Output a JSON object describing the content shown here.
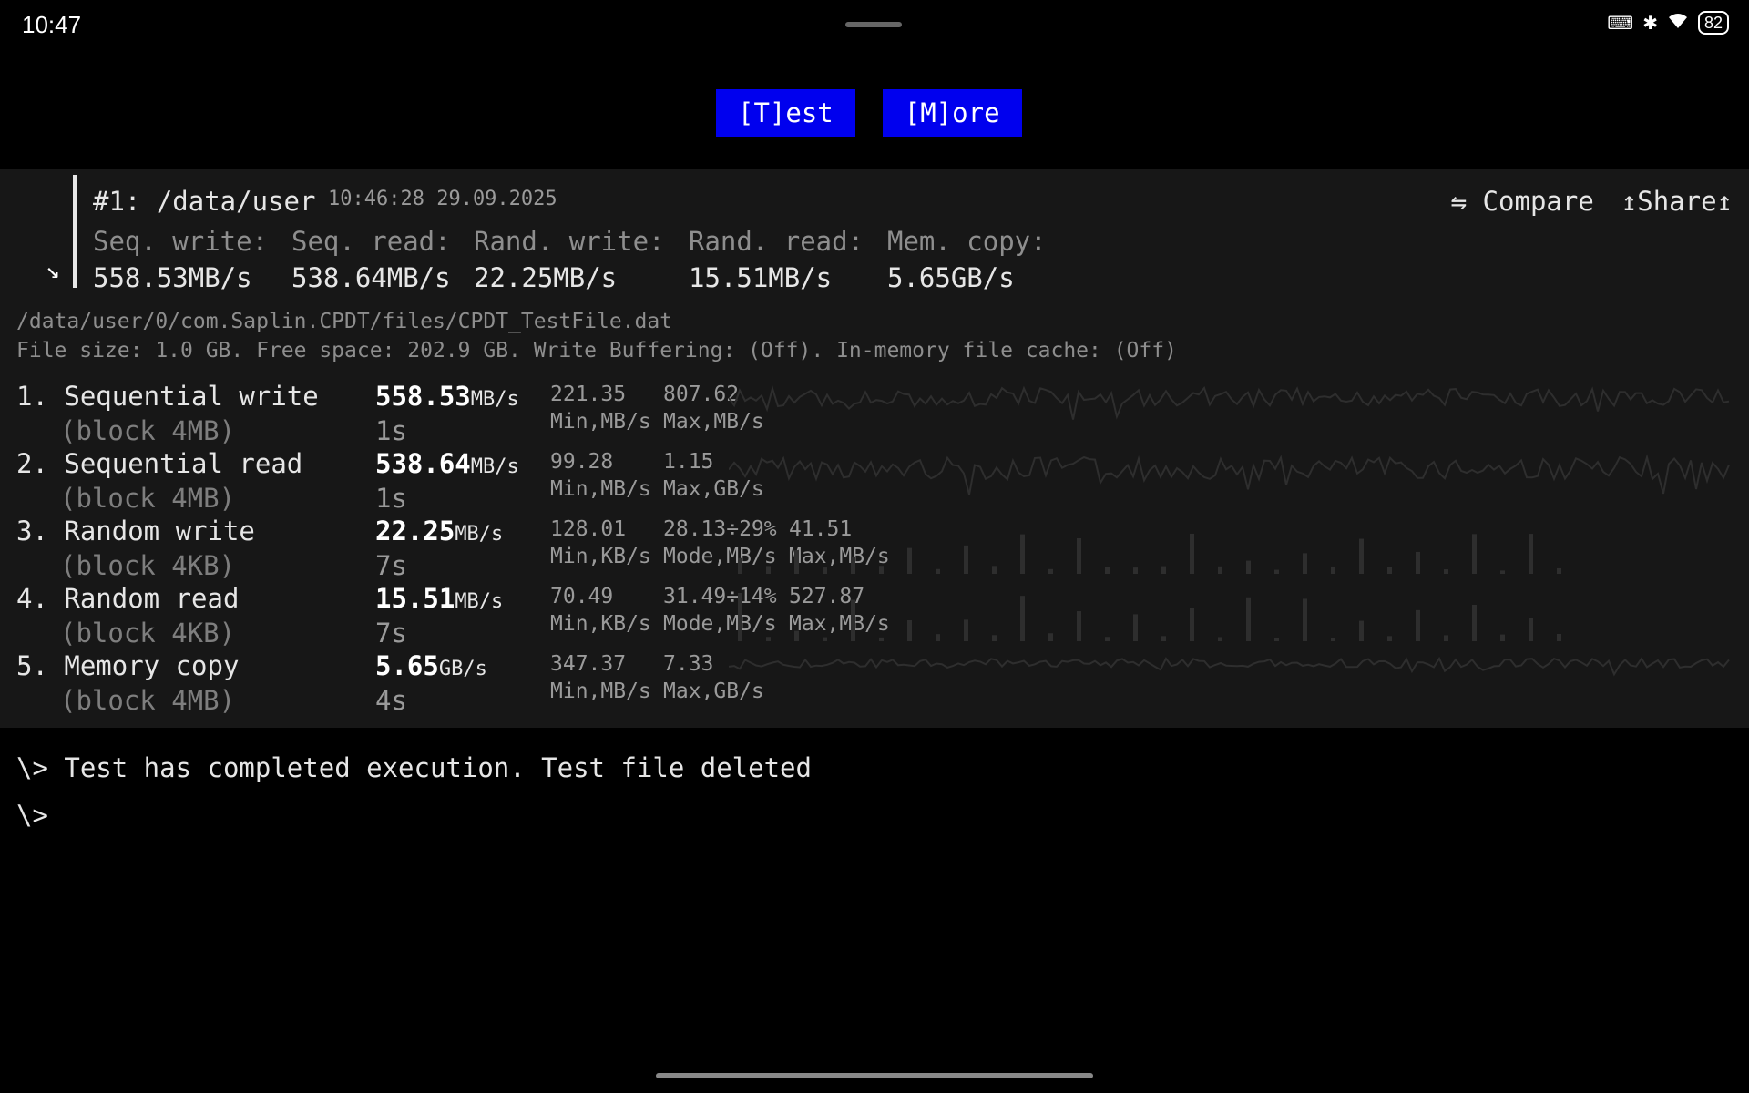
{
  "status_bar": {
    "time": "10:47",
    "battery": "82"
  },
  "toolbar": {
    "test_label": "[T]est",
    "more_label": "[M]ore"
  },
  "result_card": {
    "title": "#1: /data/user",
    "timestamp": "10:46:28 29.09.2025",
    "compare_label": "⇋ Compare",
    "share_label": "↥Share↥",
    "summary": [
      {
        "label": "Seq. write:",
        "value": "558.53MB/s"
      },
      {
        "label": "Seq. read:",
        "value": "538.64MB/s"
      },
      {
        "label": "Rand. write:",
        "value": "22.25MB/s"
      },
      {
        "label": "Rand. read:",
        "value": "15.51MB/s"
      },
      {
        "label": "Mem. copy:",
        "value": "5.65GB/s"
      }
    ]
  },
  "file_info": {
    "path": "/data/user/0/com.Saplin.CPDT/files/CPDT_TestFile.dat",
    "details": "File size: 1.0 GB. Free space: 202.9 GB. Write Buffering: (Off). In-memory file cache: (Off)"
  },
  "tests": [
    {
      "name": "1. Sequential write",
      "block": "(block 4MB)",
      "score": "558.53",
      "unit": "MB/s",
      "duration": "1s",
      "stats": [
        {
          "value": "221.35",
          "label": "Min,MB/s"
        },
        {
          "value": "807.62",
          "label": "Max,MB/s"
        }
      ]
    },
    {
      "name": "2. Sequential read",
      "block": "(block 4MB)",
      "score": "538.64",
      "unit": "MB/s",
      "duration": "1s",
      "stats": [
        {
          "value": "99.28",
          "label": "Min,MB/s"
        },
        {
          "value": "1.15",
          "label": "Max,GB/s"
        }
      ]
    },
    {
      "name": "3. Random write",
      "block": "(block 4KB)",
      "score": "22.25",
      "unit": "MB/s",
      "duration": "7s",
      "stats": [
        {
          "value": "128.01",
          "label": "Min,KB/s"
        },
        {
          "value": "28.13÷29%",
          "label": "Mode,MB/s"
        },
        {
          "value": "41.51",
          "label": "Max,MB/s"
        }
      ]
    },
    {
      "name": "4. Random read",
      "block": "(block 4KB)",
      "score": "15.51",
      "unit": "MB/s",
      "duration": "7s",
      "stats": [
        {
          "value": "70.49",
          "label": "Min,KB/s"
        },
        {
          "value": "31.49÷14%",
          "label": "Mode,MB/s"
        },
        {
          "value": "527.87",
          "label": "Max,MB/s"
        }
      ]
    },
    {
      "name": "5. Memory copy",
      "block": "(block 4MB)",
      "score": "5.65",
      "unit": "GB/s",
      "duration": "4s",
      "stats": [
        {
          "value": "347.37",
          "label": "Min,MB/s"
        },
        {
          "value": "7.33",
          "label": "Max,GB/s"
        }
      ]
    }
  ],
  "console": {
    "lines": [
      "\\> Test has completed execution. Test file deleted",
      "\\>"
    ]
  }
}
